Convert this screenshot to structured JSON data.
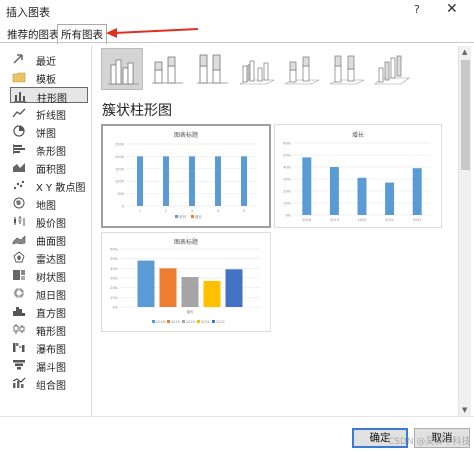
{
  "window": {
    "title": "插入图表",
    "help": "?",
    "close": "✕"
  },
  "tabs": [
    {
      "label": "推荐的图表",
      "selected": false
    },
    {
      "label": "所有图表",
      "selected": true
    }
  ],
  "sidebar": {
    "items": [
      {
        "label": "最近",
        "icon": "recent-icon"
      },
      {
        "label": "模板",
        "icon": "folder-icon"
      },
      {
        "label": "柱形图",
        "icon": "column-chart-icon",
        "selected": true
      },
      {
        "label": "折线图",
        "icon": "line-chart-icon"
      },
      {
        "label": "饼图",
        "icon": "pie-chart-icon"
      },
      {
        "label": "条形图",
        "icon": "bar-chart-icon"
      },
      {
        "label": "面积图",
        "icon": "area-chart-icon"
      },
      {
        "label": "X Y 散点图",
        "icon": "scatter-chart-icon"
      },
      {
        "label": "地图",
        "icon": "map-chart-icon"
      },
      {
        "label": "股价图",
        "icon": "stock-chart-icon"
      },
      {
        "label": "曲面图",
        "icon": "surface-chart-icon"
      },
      {
        "label": "雷达图",
        "icon": "radar-chart-icon"
      },
      {
        "label": "树状图",
        "icon": "treemap-chart-icon"
      },
      {
        "label": "旭日图",
        "icon": "sunburst-chart-icon"
      },
      {
        "label": "直方图",
        "icon": "histogram-chart-icon"
      },
      {
        "label": "箱形图",
        "icon": "box-chart-icon"
      },
      {
        "label": "瀑布图",
        "icon": "waterfall-chart-icon"
      },
      {
        "label": "漏斗图",
        "icon": "funnel-chart-icon"
      },
      {
        "label": "组合图",
        "icon": "combo-chart-icon"
      }
    ]
  },
  "section": {
    "title": "簇状柱形图"
  },
  "previews": {
    "p1": {
      "title": "图表标题",
      "yticks": [
        "2500",
        "2000",
        "1500",
        "1000",
        "500",
        "0"
      ],
      "xticks": [
        "1",
        "2",
        "3",
        "4",
        "5"
      ],
      "legend": [
        "系列",
        "增长"
      ]
    },
    "p2": {
      "title": "增长",
      "yticks": [
        "60%",
        "50%",
        "40%",
        "30%",
        "20%",
        "10%",
        "0%"
      ],
      "xticks": [
        "2018",
        "2019",
        "2020",
        "2021",
        "2022"
      ]
    },
    "p3": {
      "title": "图表标题",
      "yticks": [
        "60%",
        "50%",
        "40%",
        "30%",
        "20%",
        "10%",
        "0%"
      ],
      "xlabel": "增长",
      "legend": [
        "2018",
        "2019",
        "2020",
        "2021",
        "2022"
      ]
    }
  },
  "colors": {
    "blue": "#5b9bd5",
    "orange": "#ed7d31",
    "gray": "#a5a5a5",
    "yellow": "#ffc000",
    "darkblue": "#4472c4",
    "accent": "#3a7bd5",
    "arrow": "#e03020"
  },
  "chart_data": [
    {
      "type": "bar",
      "title": "图表标题",
      "categories": [
        "1",
        "2",
        "3",
        "4",
        "5"
      ],
      "series": [
        {
          "name": "系列",
          "values": [
            2000,
            2000,
            2000,
            2000,
            2000
          ]
        },
        {
          "name": "增长",
          "values": [
            0,
            0,
            0,
            0,
            0
          ]
        }
      ],
      "ylim": [
        0,
        2500
      ]
    },
    {
      "type": "bar",
      "title": "增长",
      "categories": [
        "2018",
        "2019",
        "2020",
        "2021",
        "2022"
      ],
      "values": [
        0.48,
        0.4,
        0.31,
        0.27,
        0.39
      ],
      "ylim": [
        0,
        0.6
      ]
    },
    {
      "type": "bar",
      "title": "图表标题",
      "xlabel": "增长",
      "categories": [
        "增长"
      ],
      "series": [
        {
          "name": "2018",
          "values": [
            0.48
          ]
        },
        {
          "name": "2019",
          "values": [
            0.4
          ]
        },
        {
          "name": "2020",
          "values": [
            0.31
          ]
        },
        {
          "name": "2021",
          "values": [
            0.27
          ]
        },
        {
          "name": "2022",
          "values": [
            0.39
          ]
        }
      ],
      "ylim": [
        0,
        0.6
      ]
    }
  ],
  "footer": {
    "ok": "确定",
    "cancel": "取消"
  },
  "watermark": "CSDN @吴柳平科技"
}
